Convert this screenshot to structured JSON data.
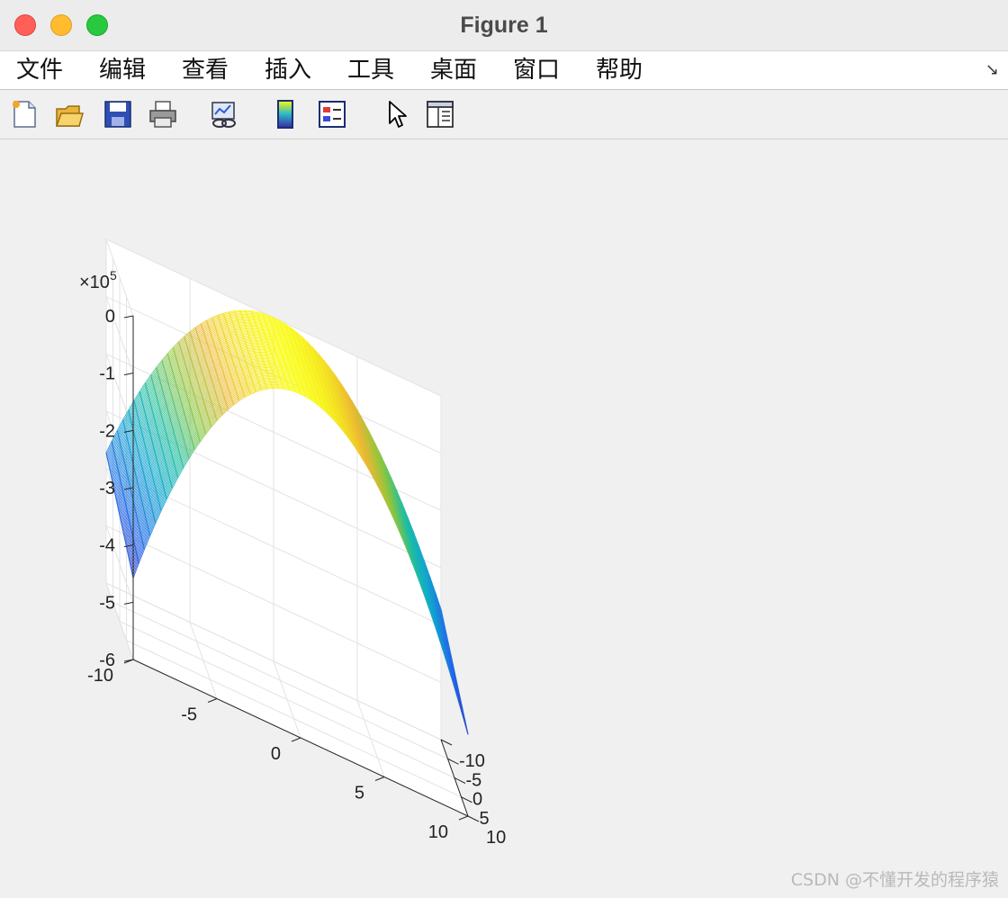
{
  "window": {
    "title": "Figure 1"
  },
  "menu": {
    "items": [
      "文件",
      "编辑",
      "查看",
      "插入",
      "工具",
      "桌面",
      "窗口",
      "帮助"
    ],
    "overflow_icon": "↘"
  },
  "toolbar": {
    "buttons": [
      {
        "icon": "new-figure-icon"
      },
      {
        "icon": "open-file-icon"
      },
      {
        "icon": "save-icon"
      },
      {
        "icon": "print-icon"
      },
      {
        "icon": "link-plot-icon"
      },
      {
        "icon": "colorbar-icon"
      },
      {
        "icon": "legend-icon"
      },
      {
        "icon": "pointer-icon"
      },
      {
        "icon": "property-inspector-icon"
      }
    ]
  },
  "chart_data": {
    "type": "surface",
    "mesh": true,
    "colormap": "parula",
    "x_ticks": [
      "-10",
      "-5",
      "0",
      "5",
      "10"
    ],
    "y_ticks": [
      "-10",
      "-5",
      "0",
      "5",
      "10"
    ],
    "z_ticks": [
      "0",
      "-1",
      "-2",
      "-3",
      "-4",
      "-5",
      "-6"
    ],
    "z_multiplier": "×10",
    "z_exponent": "5",
    "xlim": [
      -10,
      10
    ],
    "ylim": [
      -10,
      10
    ],
    "zlim": [
      -600000,
      0
    ],
    "grid": true,
    "surface_z_min": -500000,
    "surface_z_max": 0,
    "sample_points": [
      {
        "x": -10,
        "y": -10,
        "z": -500000
      },
      {
        "x": -10,
        "y": 10,
        "z": -330000
      },
      {
        "x": 0,
        "y": -10,
        "z": -60000
      },
      {
        "x": 0,
        "y": 0,
        "z": 0
      },
      {
        "x": 0,
        "y": 10,
        "z": 0
      },
      {
        "x": 10,
        "y": -10,
        "z": -360000
      },
      {
        "x": 10,
        "y": 10,
        "z": -210000
      }
    ]
  },
  "watermark": "CSDN @不懂开发的程序猿"
}
